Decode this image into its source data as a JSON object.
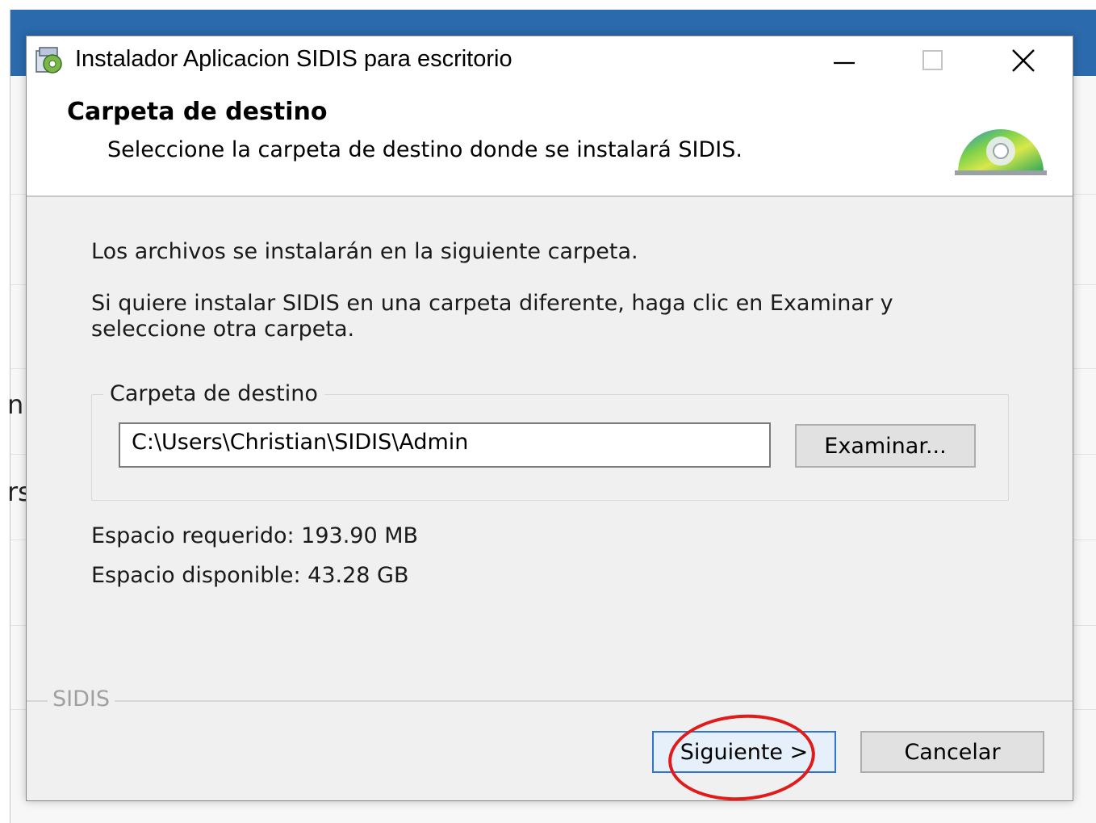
{
  "window": {
    "title": "Instalador Aplicacion SIDIS para escritorio"
  },
  "background_fragments": [
    "n",
    "rs"
  ],
  "header": {
    "title": "Carpeta de destino",
    "subtitle": "Seleccione la carpeta de destino donde se instalará SIDIS.",
    "icon": "cd-icon"
  },
  "body": {
    "intro": "Los archivos se instalarán en la siguiente carpeta.",
    "instructions_line1": "Si quiere instalar SIDIS en una carpeta diferente, haga clic en Examinar y",
    "instructions_line2": "seleccione otra carpeta."
  },
  "destination": {
    "group_label": "Carpeta de destino",
    "path": "C:\\Users\\Christian\\SIDIS\\Admin",
    "browse_label": "Examinar..."
  },
  "space": {
    "required": "Espacio requerido: 193.90 MB",
    "available": "Espacio disponible: 43.28 GB"
  },
  "footer": {
    "brand": "SIDIS",
    "next_label": "Siguiente >",
    "cancel_label": "Cancelar"
  },
  "colors": {
    "titlebar_bg": "#2b6aad",
    "dialog_bg": "#f0f0f0",
    "focus_border": "#2f74cf",
    "highlight": "#e11a1a"
  }
}
